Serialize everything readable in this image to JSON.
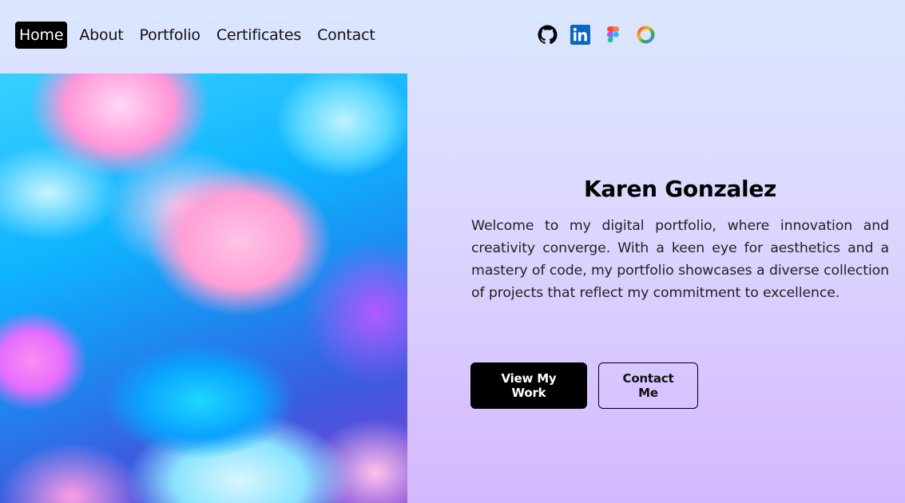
{
  "nav": {
    "items": [
      {
        "label": "Home",
        "active": true
      },
      {
        "label": "About",
        "active": false
      },
      {
        "label": "Portfolio",
        "active": false
      },
      {
        "label": "Certificates",
        "active": false
      },
      {
        "label": "Contact",
        "active": false
      }
    ]
  },
  "social": {
    "icons": [
      "github-icon",
      "linkedin-icon",
      "figma-icon",
      "ring-logo-icon"
    ]
  },
  "hero": {
    "name": "Karen Gonzalez",
    "intro": "Welcome to my digital portfolio, where innovation and creativity converge. With a keen eye for aesthetics and a mastery of code, my portfolio showcases a diverse collection of projects that reflect my commitment to excellence.",
    "primary_button": "View My Work",
    "secondary_button": "Contact Me"
  },
  "colors": {
    "background_top": "#dbe7ff",
    "background_bottom": "#d4b8ff",
    "nav_active_bg": "#000000",
    "primary_button_bg": "#000000"
  }
}
